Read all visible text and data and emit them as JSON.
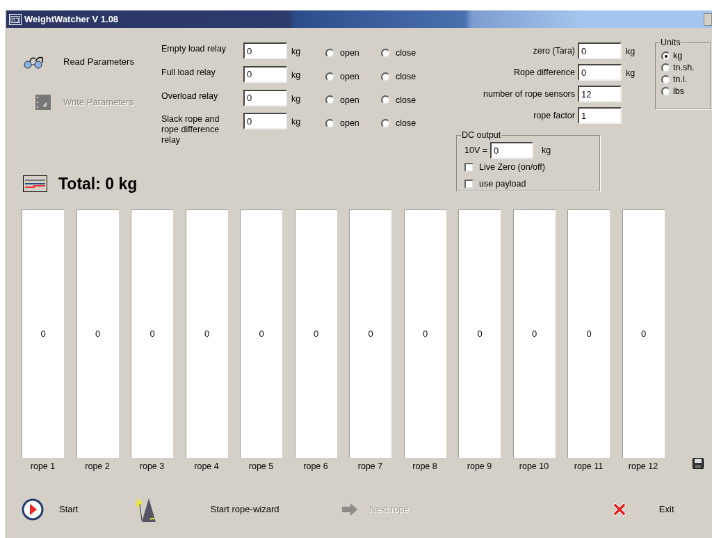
{
  "window": {
    "title": "WeightWatcher V 1.08"
  },
  "actions": [
    {
      "label": "Read Parameters",
      "disabled": false
    },
    {
      "label": "Write Parameters",
      "disabled": true
    }
  ],
  "relays": [
    {
      "label": "Empty load relay",
      "value": "0",
      "unit": "kg",
      "options": [
        {
          "label": "open",
          "selected": false
        },
        {
          "label": "close",
          "selected": false
        }
      ]
    },
    {
      "label": "Full load relay",
      "value": "0",
      "unit": "kg",
      "options": [
        {
          "label": "open",
          "selected": false
        },
        {
          "label": "close",
          "selected": false
        }
      ]
    },
    {
      "label": "Overload relay",
      "value": "0",
      "unit": "kg",
      "options": [
        {
          "label": "open",
          "selected": false
        },
        {
          "label": "close",
          "selected": false
        }
      ]
    },
    {
      "label": "Slack rope and rope difference relay",
      "value": "0",
      "unit": "kg",
      "options": [
        {
          "label": "open",
          "selected": false
        },
        {
          "label": "close",
          "selected": false
        }
      ]
    }
  ],
  "settings": [
    {
      "label": "zero (Tara)",
      "value": "0",
      "unit": "kg"
    },
    {
      "label": "Rope difference",
      "value": "0",
      "unit": "kg"
    },
    {
      "label": "number of rope sensors",
      "value": "12"
    },
    {
      "label": "rope factor",
      "value": "1"
    }
  ],
  "dc_output": {
    "title": "DC output",
    "label": "10V =",
    "value": "0",
    "unit": "kg",
    "checkboxes": [
      {
        "label": "Live Zero (on/off)",
        "checked": false
      },
      {
        "label": "use payload",
        "checked": false
      }
    ]
  },
  "units": {
    "title": "Units",
    "options": [
      {
        "label": "kg",
        "selected": true
      },
      {
        "label": "tn.sh.",
        "selected": false
      },
      {
        "label": "tn.l.",
        "selected": false
      },
      {
        "label": "lbs",
        "selected": false
      }
    ]
  },
  "total": "Total: 0 kg",
  "ropes": [
    {
      "value": "0",
      "label": "rope 1"
    },
    {
      "value": "0",
      "label": "rope 2"
    },
    {
      "value": "0",
      "label": "rope 3"
    },
    {
      "value": "0",
      "label": "rope 4"
    },
    {
      "value": "0",
      "label": "rope 5"
    },
    {
      "value": "0",
      "label": "rope 6"
    },
    {
      "value": "0",
      "label": "rope 7"
    },
    {
      "value": "0",
      "label": "rope 8"
    },
    {
      "value": "0",
      "label": "rope 9"
    },
    {
      "value": "0",
      "label": "rope 10"
    },
    {
      "value": "0",
      "label": "rope 11"
    },
    {
      "value": "0",
      "label": "rope 12"
    }
  ],
  "buttons": [
    {
      "kind": "start",
      "label": "Start",
      "disabled": false
    },
    {
      "kind": "wizard",
      "label": "Start rope-wizard",
      "disabled": false
    },
    {
      "kind": "next",
      "label": "Next rope",
      "disabled": true
    },
    {
      "kind": "exit",
      "label": "Exit",
      "disabled": false
    }
  ]
}
